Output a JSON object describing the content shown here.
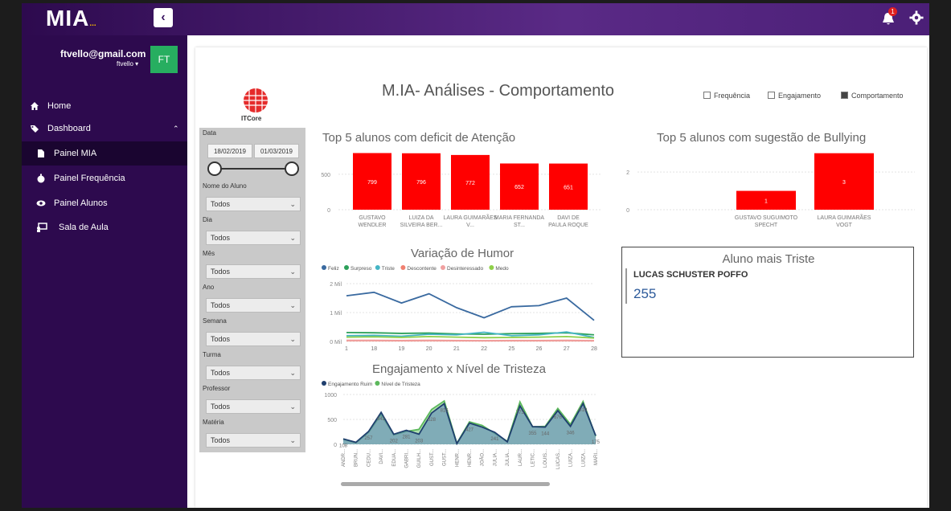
{
  "app": {
    "logo": "MIA",
    "logo_dots": "...",
    "collapse_icon": "chevron-left-icon",
    "notification_count": "1"
  },
  "user": {
    "email": "ftvello@gmail.com",
    "name": "ftvello",
    "initials": "FT"
  },
  "nav": [
    {
      "label": "Home",
      "icon": "home-icon"
    },
    {
      "label": "Dashboard",
      "icon": "tags-icon"
    },
    {
      "label": "Painel MIA",
      "icon": "file-icon"
    },
    {
      "label": "Painel Frequência",
      "icon": "stopwatch-icon"
    },
    {
      "label": "Painel Alunos",
      "icon": "eye-icon"
    },
    {
      "label": "Sala de Aula",
      "icon": "classroom-icon"
    }
  ],
  "report": {
    "title": "M.IA- Análises - Comportamento",
    "toggles": [
      {
        "label": "Frequência",
        "checked": false
      },
      {
        "label": "Engajamento",
        "checked": false
      },
      {
        "label": "Comportamento",
        "checked": true
      }
    ],
    "brand": "ITCore"
  },
  "filters": {
    "date_label": "Data",
    "date_from": "18/02/2019",
    "date_to": "01/03/2019",
    "fields": [
      {
        "label": "Nome do Aluno",
        "value": "Todos"
      },
      {
        "label": "Dia",
        "value": "Todos"
      },
      {
        "label": "Mês",
        "value": "Todos"
      },
      {
        "label": "Ano",
        "value": "Todos"
      },
      {
        "label": "Semana",
        "value": "Todos"
      },
      {
        "label": "Turma",
        "value": "Todos"
      },
      {
        "label": "Professor",
        "value": "Todos"
      },
      {
        "label": "Matéria",
        "value": "Todos"
      }
    ]
  },
  "sad_student": {
    "title": "Aluno mais Triste",
    "name": "LUCAS SCHUSTER POFFO",
    "value": "255"
  },
  "chart_data": [
    {
      "type": "bar",
      "title": "Top 5  alunos  com deficit de Atenção",
      "categories": [
        "GUSTAVO WENDLER",
        "LUIZA DA SILVEIRA BER...",
        "LAURA GUIMARÃES V...",
        "MARIA FERNANDA ST...",
        "DAVI DE PAULA ROQUE"
      ],
      "values": [
        799,
        796,
        772,
        652,
        651
      ],
      "yticks": [
        0,
        500
      ],
      "ylim": [
        0,
        850
      ],
      "color": "#ff0000"
    },
    {
      "type": "bar",
      "title": "Top 5 alunos com sugestão de Bullying",
      "categories": [
        "GUSTAVO SUGUIMOTO SPECHT",
        "LAURA GUIMARÃES VOGT"
      ],
      "values": [
        1,
        3
      ],
      "yticks": [
        0,
        2
      ],
      "ylim": [
        0,
        3.2
      ],
      "color": "#ff0000"
    },
    {
      "type": "line",
      "title": "Variação de Humor",
      "x": [
        "1",
        "18",
        "19",
        "20",
        "21",
        "22",
        "25",
        "26",
        "27",
        "28"
      ],
      "yticks": [
        "0 Mil",
        "1 Mil",
        "2 Mil"
      ],
      "ylim": [
        0,
        2000
      ],
      "series": [
        {
          "name": "Feliz",
          "color": "#3a6aa0",
          "values": [
            1580,
            1700,
            1330,
            1650,
            1170,
            820,
            1200,
            1240,
            1500,
            730
          ]
        },
        {
          "name": "Surpreso",
          "color": "#2ca05a",
          "values": [
            310,
            300,
            280,
            290,
            260,
            250,
            270,
            280,
            300,
            230
          ]
        },
        {
          "name": "Triste",
          "color": "#45b5c5",
          "values": [
            200,
            210,
            180,
            250,
            230,
            320,
            200,
            230,
            330,
            140
          ]
        },
        {
          "name": "Descontente",
          "color": "#f08070",
          "values": [
            30,
            30,
            25,
            30,
            25,
            20,
            25,
            25,
            30,
            20
          ]
        },
        {
          "name": "Desinteressado",
          "color": "#f0a0a0",
          "values": [
            40,
            40,
            35,
            40,
            35,
            30,
            35,
            35,
            40,
            30
          ]
        },
        {
          "name": "Medo",
          "color": "#8fd04a",
          "values": [
            150,
            160,
            140,
            170,
            150,
            130,
            140,
            150,
            170,
            120
          ]
        }
      ]
    },
    {
      "type": "area",
      "title": "Engajamento  x Nível de Tristeza",
      "categories": [
        "ANDR...",
        "BRUN...",
        "CEDU...",
        "DAVI...",
        "EDUA...",
        "GABRI...",
        "GUILH...",
        "GUST...",
        "GUST...",
        "HENR...",
        "HENR...",
        "JOÃO...",
        "JULIA...",
        "JULIA...",
        "LAUR...",
        "LETIC...",
        "LOUIS...",
        "LUCAS...",
        "LUIZA...",
        "LUIZA...",
        "MARI..."
      ],
      "yticks": [
        0,
        500,
        1000
      ],
      "ylim": [
        0,
        1000
      ],
      "series": [
        {
          "name": "Engajamento Ruim",
          "color": "#1f3f6e",
          "values": [
            108,
            40,
            257,
            642,
            202,
            281,
            203,
            628,
            816,
            15,
            427,
            346,
            241,
            50,
            773,
            355,
            346,
            676,
            361,
            819,
            175
          ]
        },
        {
          "name": "Nível de Tristeza",
          "color": "#5cb85c",
          "values": [
            100,
            30,
            240,
            600,
            190,
            260,
            300,
            700,
            870,
            20,
            450,
            380,
            220,
            60,
            850,
            350,
            360,
            720,
            400,
            860,
            160
          ]
        }
      ],
      "data_labels": [
        "108",
        "",
        "257",
        "642",
        "202",
        "281",
        "203",
        "628",
        "816",
        "",
        "427",
        "",
        "241",
        "",
        "773",
        "355",
        "144",
        "676",
        "346",
        "819",
        "175"
      ]
    }
  ]
}
